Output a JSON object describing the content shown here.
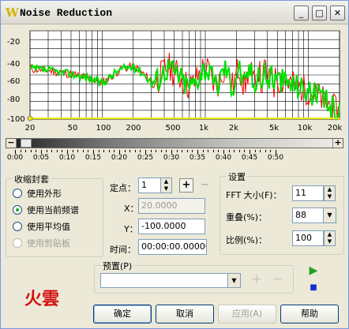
{
  "window": {
    "title": "Noise Reduction",
    "app_icon_glyph": "W",
    "buttons": {
      "minimize": "_",
      "maximize": "□",
      "close": "✕"
    }
  },
  "graph": {
    "db_labels": [
      "-20",
      "-40",
      "-60",
      "-80",
      "-100"
    ],
    "freq_labels": [
      "20",
      "50",
      "100",
      "200",
      "500",
      "1k",
      "2k",
      "5k",
      "10k",
      "20k"
    ],
    "colors": {
      "background": "#ffffff",
      "grid": "#000000",
      "noise_profile": "#00e000",
      "spectrum": "#ff0000",
      "floor_line": "#e8e800"
    }
  },
  "scrollbar": {
    "left_button": "−",
    "right_button": "+"
  },
  "time_ruler": {
    "labels": [
      "0:00",
      "0:05",
      "0:10",
      "0:15",
      "0:20",
      "0:25",
      "0:30",
      "0:35",
      "0:40",
      "0:45",
      "0:50"
    ]
  },
  "envelope": {
    "title": "收缩封套",
    "options": [
      {
        "label": "使用外形",
        "selected": false,
        "enabled": true
      },
      {
        "label": "使用当前频谱",
        "selected": true,
        "enabled": true
      },
      {
        "label": "使用平均值",
        "selected": false,
        "enabled": true
      },
      {
        "label": "使用剪贴板",
        "selected": false,
        "enabled": false
      }
    ]
  },
  "points": {
    "point_label": "定点：",
    "point_value": "1",
    "x_label": "X：",
    "x_value": "20.0000",
    "y_label": "Y：",
    "y_value": "-100.0000",
    "time_label": "时间：",
    "time_value": "00:00:00.00000"
  },
  "settings": {
    "title": "设置",
    "fft_label": "FFT 大小(F)：",
    "fft_value": "11",
    "overlap_label": "重叠(%)：",
    "overlap_value": "88",
    "ratio_label": "比例(%)：",
    "ratio_value": "100"
  },
  "preset": {
    "title": "预置(P)",
    "value": ""
  },
  "logo_text": "火雲",
  "buttons": {
    "ok": "确定",
    "cancel": "取消",
    "apply": "应用(A)",
    "help": "帮助"
  }
}
